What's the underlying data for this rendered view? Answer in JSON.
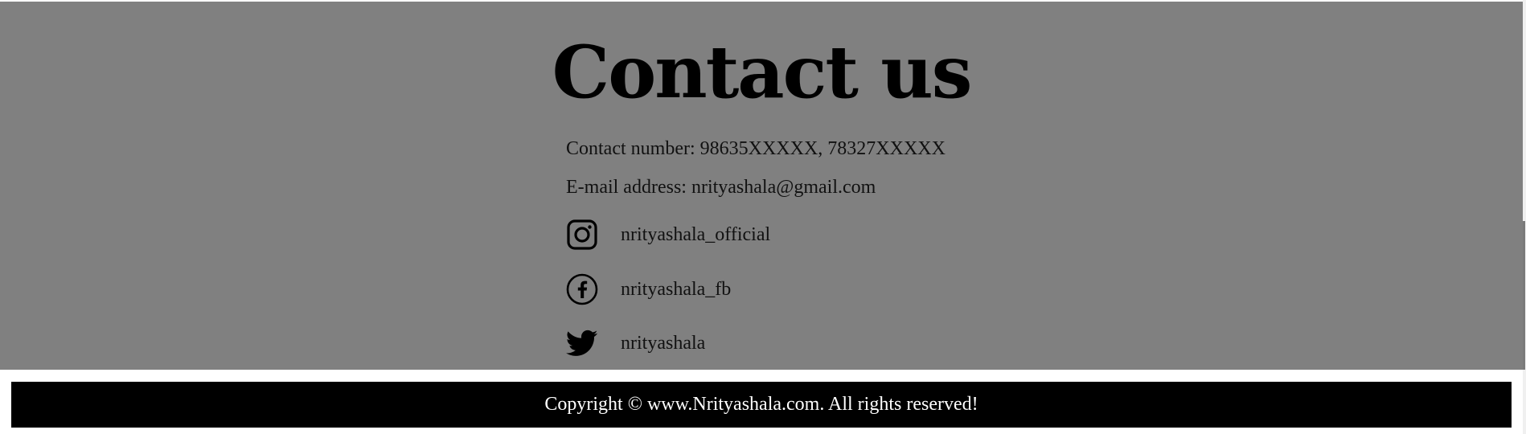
{
  "contact": {
    "title": "Contact us",
    "phone_line": "Contact number: 98635XXXXX, 78327XXXXX",
    "email_line": "E-mail address: nrityashala@gmail.com",
    "socials": [
      {
        "icon": "instagram-icon",
        "handle": "nrityashala_official"
      },
      {
        "icon": "facebook-icon",
        "handle": "nrityashala_fb"
      },
      {
        "icon": "twitter-icon",
        "handle": "nrityashala"
      }
    ]
  },
  "footer": {
    "copyright": "Copyright © www.Nrityashala.com. All rights reserved!"
  },
  "colors": {
    "section_bg": "#808080",
    "footer_bg": "#000000",
    "footer_text": "#ffffff",
    "text": "#111111"
  }
}
